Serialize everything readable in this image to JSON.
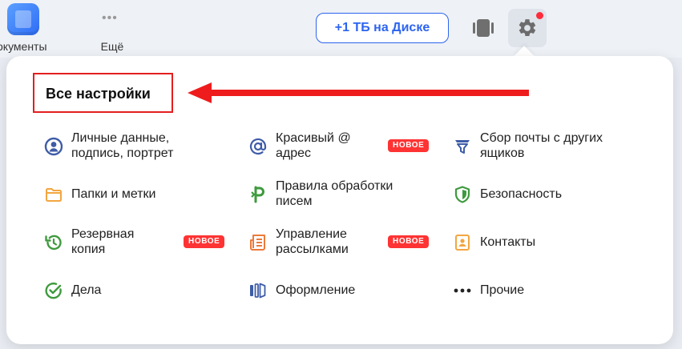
{
  "topbar": {
    "docs_label": "окументы",
    "more_label": "Ещё",
    "disk_button": "+1 ТБ на Диске"
  },
  "menu": {
    "title": "Все настройки",
    "badge": "НОВОЕ",
    "items": [
      {
        "label": "Личные данные, подпись, портрет",
        "icon": "person-circle-icon",
        "color": "#3e5ca7"
      },
      {
        "label": "Красивый @ адрес",
        "icon": "at-sign-icon",
        "color": "#3e5ca7",
        "badge": true
      },
      {
        "label": "Сбор почты с других ящиков",
        "icon": "funnel-icon",
        "color": "#3e5ca7"
      },
      {
        "label": "Папки и метки",
        "icon": "folder-icon",
        "color": "#f2a640"
      },
      {
        "label": "Правила обработки писем",
        "icon": "rules-icon",
        "color": "#3e9a3e"
      },
      {
        "label": "Безопасность",
        "icon": "shield-icon",
        "color": "#3e9a3e"
      },
      {
        "label": "Резервная копия",
        "icon": "backup-icon",
        "color": "#3e9a3e",
        "badge": true
      },
      {
        "label": "Управление рассылками",
        "icon": "newsletter-icon",
        "color": "#ec7a3a",
        "badge": true
      },
      {
        "label": "Контакты",
        "icon": "contacts-icon",
        "color": "#f2a640"
      },
      {
        "label": "Дела",
        "icon": "check-circle-icon",
        "color": "#3e9a3e"
      },
      {
        "label": "Оформление",
        "icon": "theme-icon",
        "color": "#3e5ca7"
      },
      {
        "label": "Прочие",
        "icon": "more-dots-icon",
        "color": "#222222"
      }
    ]
  }
}
